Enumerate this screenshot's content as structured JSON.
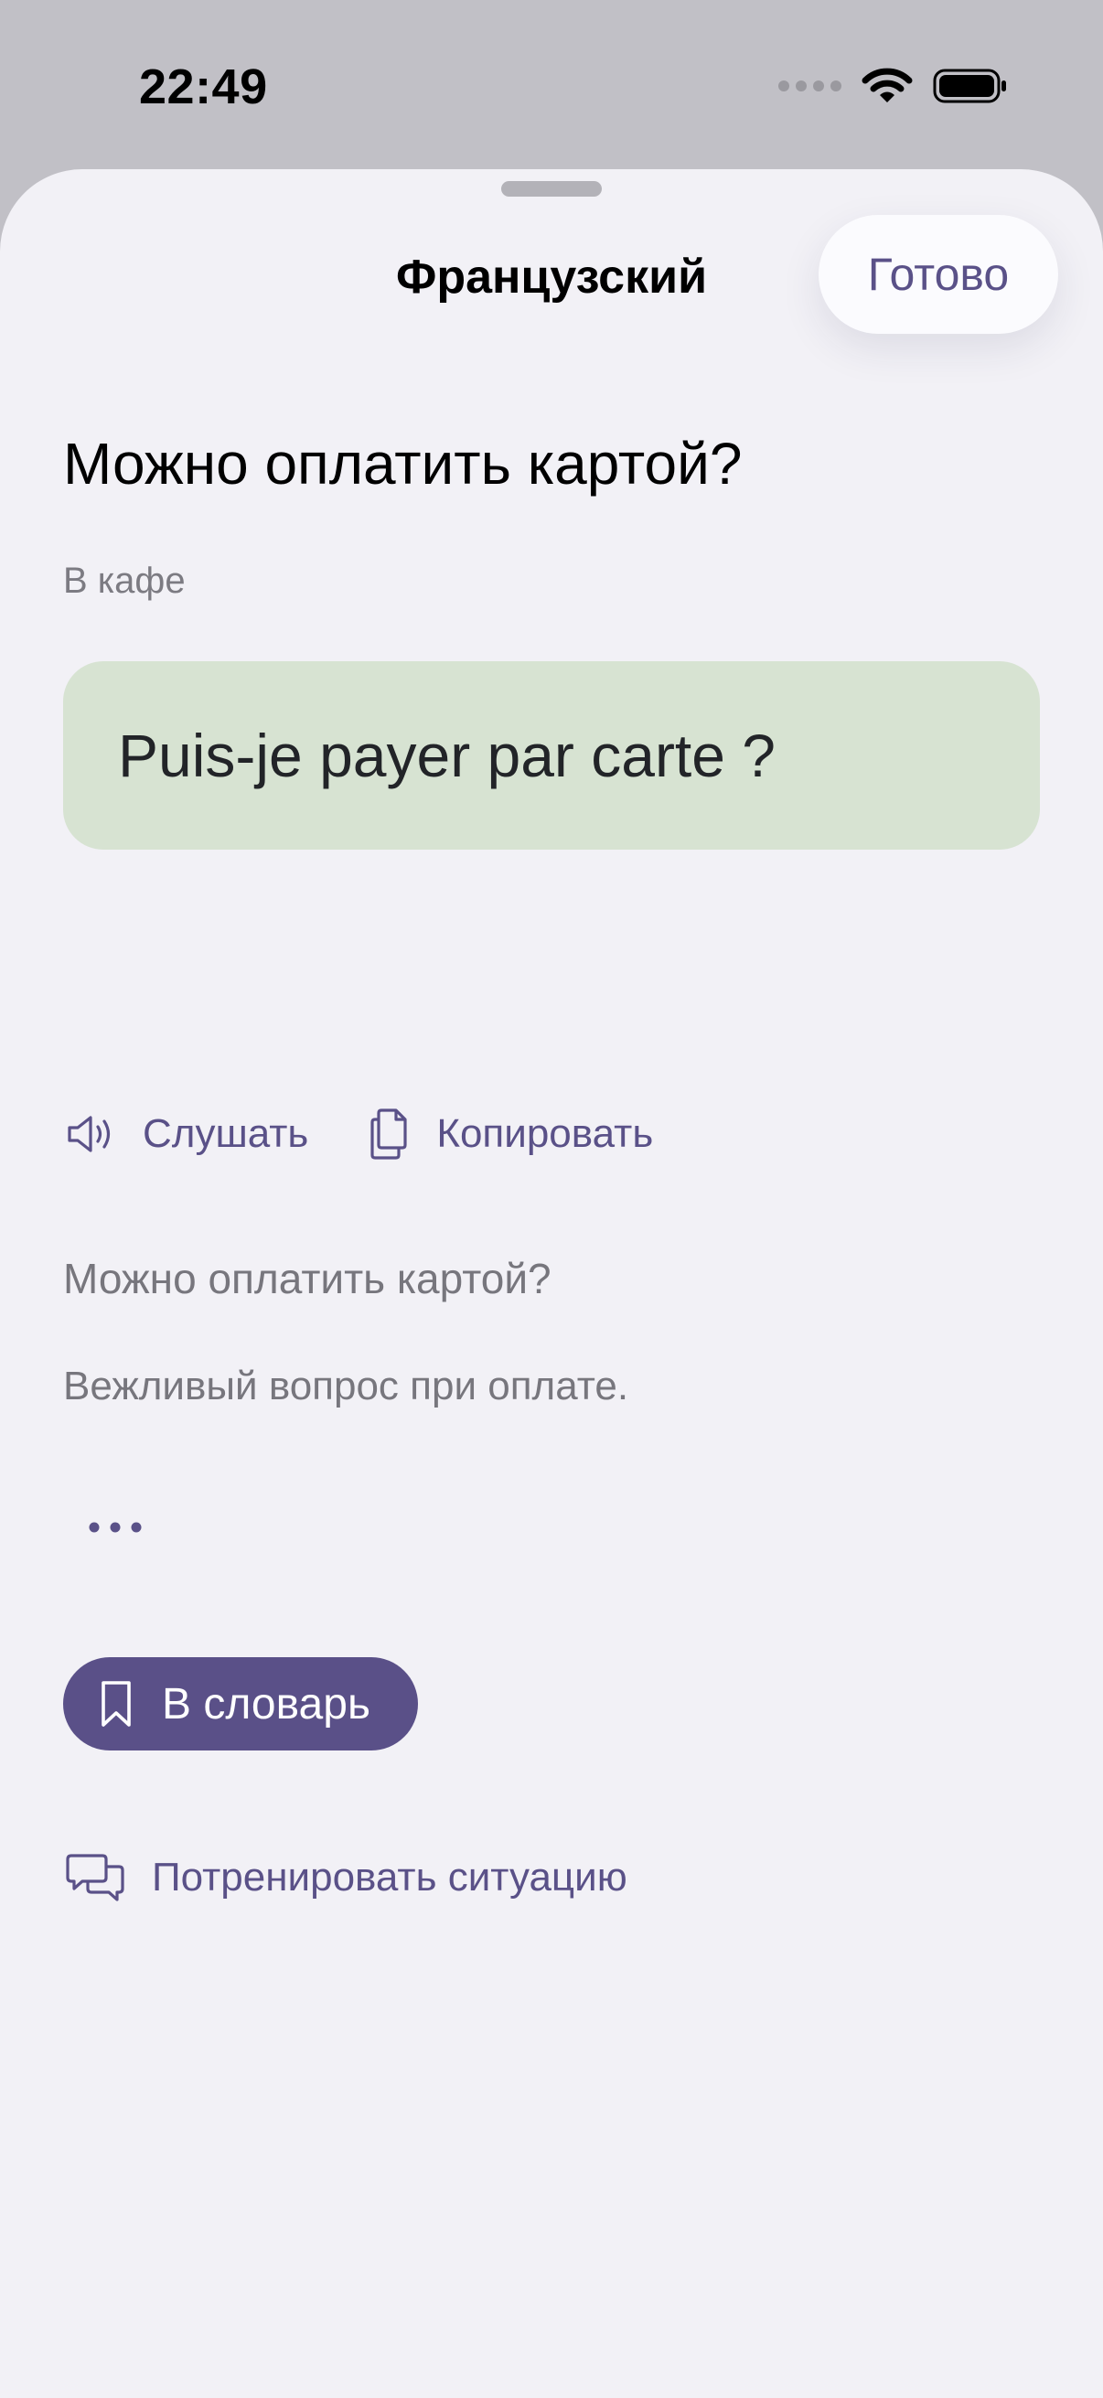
{
  "status_bar": {
    "time": "22:49"
  },
  "header": {
    "title": "Французский",
    "done_label": "Готово"
  },
  "phrase": {
    "title": "Можно оплатить картой?",
    "context": "В кафе",
    "translation": "Puis-je payer par carte ?",
    "original": "Можно оплатить картой?",
    "note": "Вежливый вопрос при оплате."
  },
  "actions": {
    "listen_label": "Слушать",
    "copy_label": "Копировать",
    "add_to_dictionary_label": "В словарь",
    "practice_label": "Потренировать ситуацию"
  },
  "icons": {
    "listen": "speaker-icon",
    "copy": "copy-icon",
    "more": "ellipsis-icon",
    "bookmark": "bookmark-icon",
    "practice": "chat-bubbles-icon"
  },
  "colors": {
    "accent": "#5a5188",
    "translation_background": "#d7e3d2",
    "sheet_background": "#f2f1f6"
  }
}
